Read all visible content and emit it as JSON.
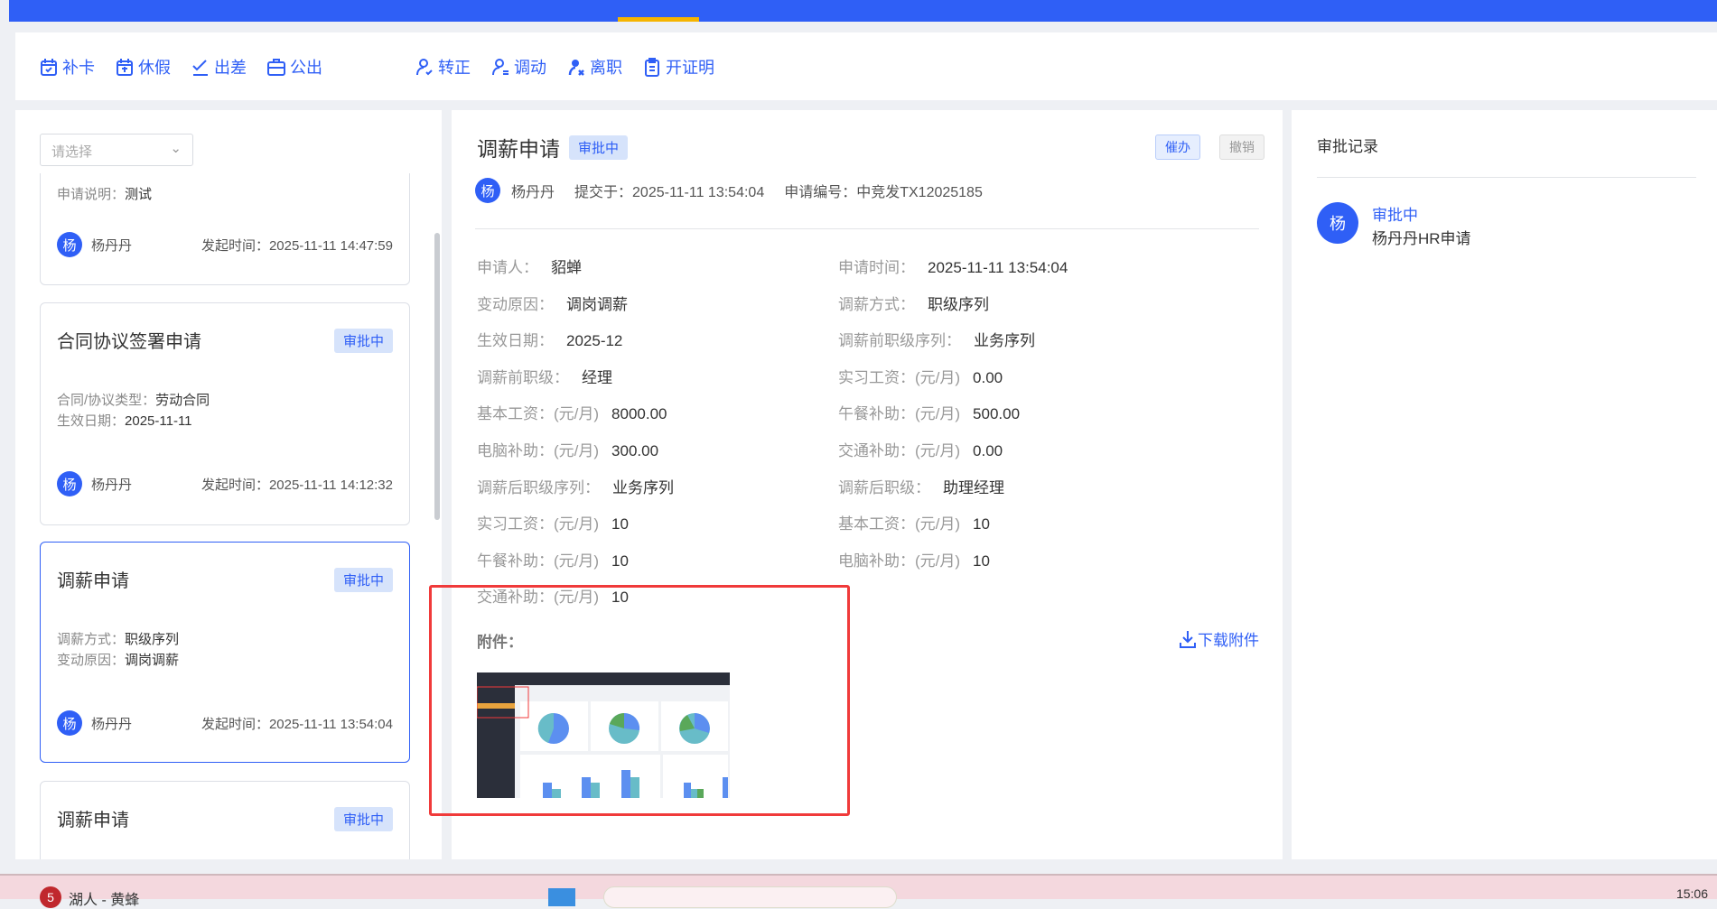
{
  "toolbar": [
    {
      "icon": "calendar-check-icon",
      "label": "补卡"
    },
    {
      "icon": "calendar-leave-icon",
      "label": "休假"
    },
    {
      "icon": "plane-icon",
      "label": "出差"
    },
    {
      "icon": "briefcase-icon",
      "label": "公出"
    },
    {
      "icon": "user-check-icon",
      "label": "转正"
    },
    {
      "icon": "user-transfer-icon",
      "label": "调动"
    },
    {
      "icon": "user-leave-icon",
      "label": "离职"
    },
    {
      "icon": "clipboard-icon",
      "label": "开证明"
    }
  ],
  "list": {
    "select_placeholder": "请选择",
    "cards": [
      {
        "lines": [
          {
            "k": "申请说明：",
            "v": "测试"
          }
        ],
        "user": "杨丹丹",
        "avatar": "杨",
        "time": "发起时间：2025-11-11 14:47:59"
      },
      {
        "title": "合同协议签署申请",
        "status": "审批中",
        "lines": [
          {
            "k": "合同/协议类型：",
            "v": "劳动合同"
          },
          {
            "k": "生效日期：",
            "v": "2025-11-11"
          }
        ],
        "user": "杨丹丹",
        "avatar": "杨",
        "time": "发起时间：2025-11-11 14:12:32"
      },
      {
        "title": "调薪申请",
        "status": "审批中",
        "lines": [
          {
            "k": "调薪方式：",
            "v": "职级序列"
          },
          {
            "k": "变动原因：",
            "v": "调岗调薪"
          }
        ],
        "user": "杨丹丹",
        "avatar": "杨",
        "time": "发起时间：2025-11-11 13:54:04"
      },
      {
        "title": "调薪申请",
        "status": "审批中"
      }
    ]
  },
  "detail": {
    "title": "调薪申请",
    "status": "审批中",
    "urge": "催办",
    "revoke": "撤销",
    "avatar": "杨",
    "user": "杨丹丹",
    "submitted": "提交于：2025-11-11 13:54:04",
    "number": "申请编号：中竞发TX12025185",
    "fields": [
      [
        "申请人：",
        "貂蝉"
      ],
      [
        "申请时间：",
        "2025-11-11 13:54:04"
      ],
      [
        "变动原因：",
        "调岗调薪"
      ],
      [
        "调薪方式：",
        "职级序列"
      ],
      [
        "生效日期：",
        "2025-12"
      ],
      [
        "调薪前职级序列：",
        "业务序列"
      ],
      [
        "调薪前职级：",
        "经理"
      ],
      [
        "实习工资：(元/月)",
        "0.00"
      ],
      [
        "基本工资：(元/月)",
        "8000.00"
      ],
      [
        "午餐补助：(元/月)",
        "500.00"
      ],
      [
        "电脑补助：(元/月)",
        "300.00"
      ],
      [
        "交通补助：(元/月)",
        "0.00"
      ],
      [
        "调薪后职级序列：",
        "业务序列"
      ],
      [
        "调薪后职级：",
        "助理经理"
      ],
      [
        "实习工资：(元/月)",
        "10"
      ],
      [
        "基本工资：(元/月)",
        "10"
      ],
      [
        "午餐补助：(元/月)",
        "10"
      ],
      [
        "电脑补助：(元/月)",
        "10"
      ],
      [
        "交通补助：(元/月)",
        "10"
      ]
    ],
    "attachments_label": "附件：",
    "download": "下载附件"
  },
  "records": {
    "title": "审批记录",
    "items": [
      {
        "avatar": "杨",
        "status": "审批中",
        "desc": "杨丹丹HR申请"
      }
    ]
  },
  "taskbar": {
    "notify_count": "5",
    "media": "湖人 - 黄蜂",
    "clock": "15:06"
  },
  "colors": {
    "primary": "#2f5ff6",
    "highlight": "#f03a3a"
  }
}
